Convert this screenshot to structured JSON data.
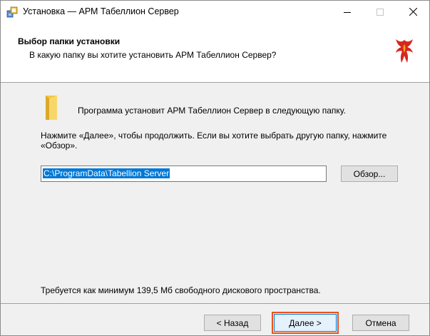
{
  "window": {
    "title": "Установка — АРМ Табеллион Сервер"
  },
  "header": {
    "title": "Выбор папки установки",
    "subtitle": "В какую папку вы хотите установить АРМ Табеллион Сервер?"
  },
  "body": {
    "intro": "Программа установит АРМ Табеллион Сервер в следующую папку.",
    "instructions": "Нажмите «Далее», чтобы продолжить. Если вы хотите выбрать другую папку, нажмите «Обзор».",
    "path_value": "C:\\ProgramData\\Tabellion Server",
    "browse_label": "Обзор...",
    "space_required": "Требуется как минимум 139,5 Мб свободного дискового пространства."
  },
  "footer": {
    "back_label": "< Назад",
    "next_label": "Далее >",
    "cancel_label": "Отмена"
  },
  "colors": {
    "selection": "#0078d7",
    "highlight_outline": "#e8531c"
  }
}
